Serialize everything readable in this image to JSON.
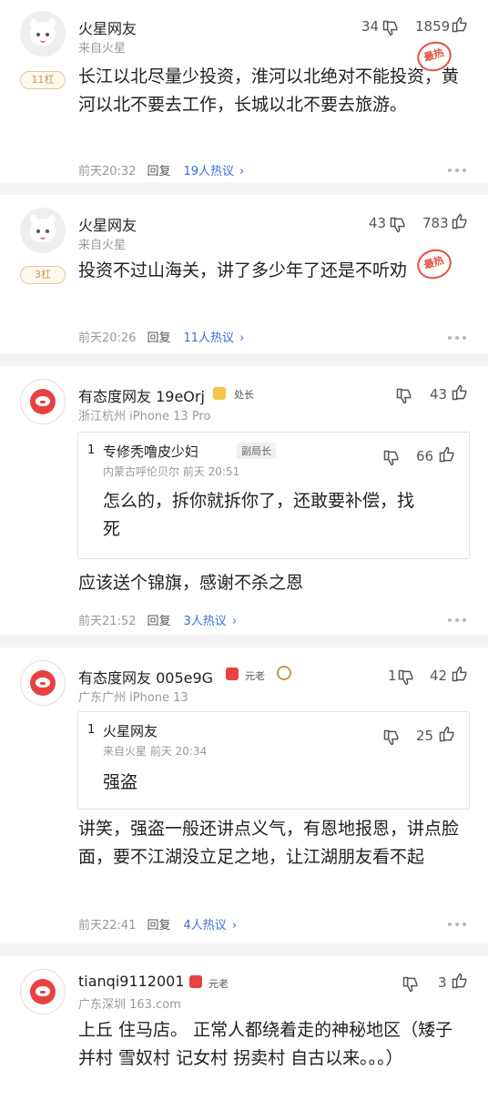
{
  "comments": [
    {
      "name": "火星网友",
      "sub": "来自火星",
      "level": "11杠",
      "hot_badge": "最热",
      "down_count": "34",
      "up_count": "1859",
      "body": "长江以北尽量少投资，淮河以北绝对不能投资，黄河以北不要去工作，长城以北不要去旅游。",
      "time": "前天20:32",
      "reply": "回复",
      "talk": "19人热议",
      "talk_arrow": "›"
    },
    {
      "name": "火星网友",
      "sub": "来自火星",
      "level": "3杠",
      "hot_badge": "最热",
      "down_count": "43",
      "up_count": "783",
      "body": "投资不过山海关，讲了多少年了还是不听劝",
      "time": "前天20:26",
      "reply": "回复",
      "talk": "11人热议",
      "talk_arrow": "›"
    },
    {
      "name": "有态度网友 19eOrj",
      "rank": "处长",
      "sub": "浙江杭州  iPhone 13 Pro",
      "up_count": "43",
      "quote": {
        "index": "1",
        "name": "专修秃噜皮少妇",
        "rank": "副局长",
        "sub": "内蒙古呼伦贝尔  前天 20:51",
        "up_count": "66",
        "body": "怎么的，拆你就拆你了，还敢要补偿，找死"
      },
      "body": "应该送个锦旗，感谢不杀之恩",
      "time": "前天21:52",
      "reply": "回复",
      "talk": "3人热议",
      "talk_arrow": "›"
    },
    {
      "name": "有态度网友 005e9G",
      "rank": "元老",
      "sub": "广东广州  iPhone 13",
      "down_count": "1",
      "up_count": "42",
      "quote": {
        "index": "1",
        "name": "火星网友",
        "sub": "来自火星  前天 20:34",
        "up_count": "25",
        "body": "强盗"
      },
      "body": "讲笑，强盗一般还讲点义气，有恩地报恩，讲点脸面，要不江湖没立足之地，让江湖朋友看不起",
      "time": "前天22:41",
      "reply": "回复",
      "talk": "4人热议",
      "talk_arrow": "›"
    },
    {
      "name": "tianqi9112001",
      "rank": "元老",
      "sub": "广东深圳  163.com",
      "up_count": "3",
      "body": "上丘 住马店。 正常人都绕着走的神秘地区（矮子并村 雪奴村 记女村 拐卖村 自古以来。。。）"
    }
  ],
  "colors": {
    "accent_blue": "#3b6fd6",
    "hot_red": "#e25141",
    "level_gold": "#c8955a",
    "avatar_red": "#e84141"
  },
  "icons": [
    "thumb-down-icon",
    "thumb-up-icon",
    "more-dots-icon",
    "chevron-right-icon",
    "shield-badge-icon",
    "pen-badge-icon"
  ]
}
